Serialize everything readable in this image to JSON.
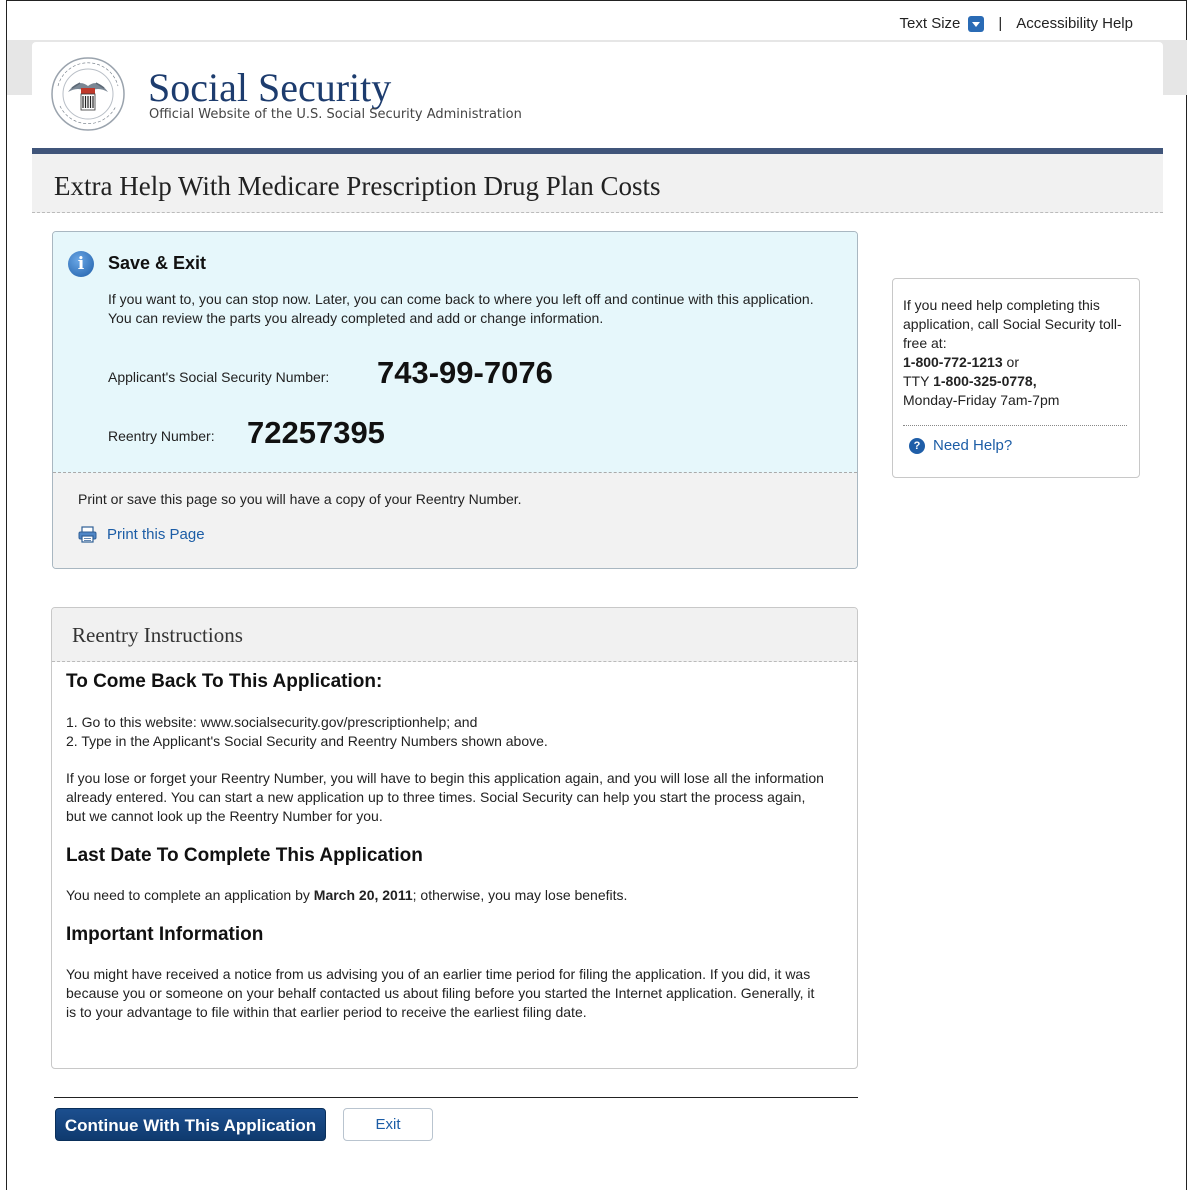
{
  "utility": {
    "text_size": "Text Size",
    "separator": "|",
    "accessibility": "Accessibility Help"
  },
  "header": {
    "title": "Social Security",
    "subtitle": "Official Website of the U.S. Social Security Administration",
    "seal_text": "SOCIAL SECURITY ADMINISTRATION USA"
  },
  "page": {
    "title": "Extra Help With Medicare Prescription Drug Plan Costs"
  },
  "save_exit": {
    "heading": "Save & Exit",
    "description": "If you want to, you can stop now. Later, you can come back to where you left off and continue with this application. You can review the parts you already completed and add or change information.",
    "ssn_label": "Applicant's Social Security Number:",
    "ssn_value": "743-99-7076",
    "reentry_label": "Reentry Number:",
    "reentry_value": "72257395",
    "print_note": "Print or save this page so you will have a copy of your Reentry Number.",
    "print_link": "Print this Page"
  },
  "help": {
    "line1": "If you need help completing this application, call Social Security toll-free at:",
    "phone": "1-800-772-1213",
    "or": " or",
    "tty_prefix": "TTY ",
    "tty": "1-800-325-0778,",
    "hours": "Monday-Friday 7am-7pm",
    "need_help": "Need Help?"
  },
  "reentry": {
    "title": "Reentry Instructions",
    "h1": "To Come Back To This Application:",
    "step1": "1. Go to this website: www.socialsecurity.gov/prescriptionhelp; and",
    "step2": "2. Type in the Applicant's Social Security and Reentry Numbers shown above.",
    "lose_text": "If you lose or forget your Reentry Number, you will have to begin this application again, and you will lose all the information already entered. You can start a new application up to three times. Social Security can help you start the process again, but we cannot look up the Reentry Number for you.",
    "h2": "Last Date To Complete This Application",
    "date_prefix": "You need to complete an application by ",
    "date": "March 20, 2011",
    "date_suffix": "; otherwise, you may lose benefits.",
    "h3": "Important Information",
    "important_text": "You might have received a notice from us advising you of an earlier time period for filing the application. If you did, it was because you or someone on your behalf contacted us about filing before you started the Internet application. Generally, it is to your advantage to file within that earlier period to receive the earliest filing date."
  },
  "buttons": {
    "continue": "Continue With This Application",
    "exit": "Exit"
  }
}
